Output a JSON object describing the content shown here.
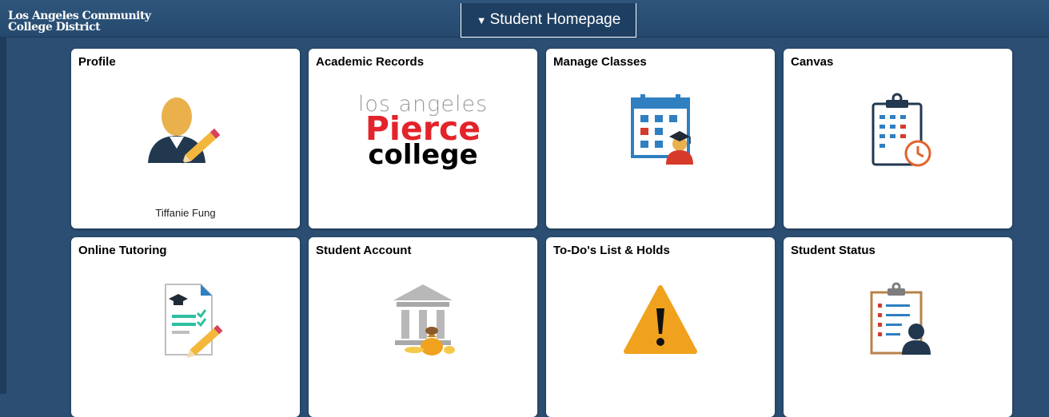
{
  "header": {
    "logo_line1": "Los Angeles Community",
    "logo_line2": "College District",
    "homepage_label": "Student Homepage"
  },
  "tiles": [
    {
      "title": "Profile",
      "subtitle": "Tiffanie Fung",
      "icon": "profile-person-pencil-icon"
    },
    {
      "title": "Academic Records",
      "icon": "pierce-college-logo",
      "logo_line1": "los angeles",
      "logo_line2": "Pierce",
      "logo_line3": "college"
    },
    {
      "title": "Manage Classes",
      "icon": "calendar-graduate-icon"
    },
    {
      "title": "Canvas",
      "icon": "clipboard-clock-icon"
    },
    {
      "title": "Online Tutoring",
      "icon": "document-cap-pencil-icon"
    },
    {
      "title": "Student Account",
      "icon": "bank-moneybag-icon"
    },
    {
      "title": "To-Do's List & Holds",
      "icon": "warning-triangle-icon"
    },
    {
      "title": "Student Status",
      "icon": "clipboard-person-icon"
    }
  ],
  "colors": {
    "background": "#2b4e72",
    "tile": "#ffffff",
    "accent_blue": "#2f7fc1",
    "accent_orange": "#f0a21e",
    "accent_red": "#d63a2b",
    "navy": "#1f3c5a"
  }
}
